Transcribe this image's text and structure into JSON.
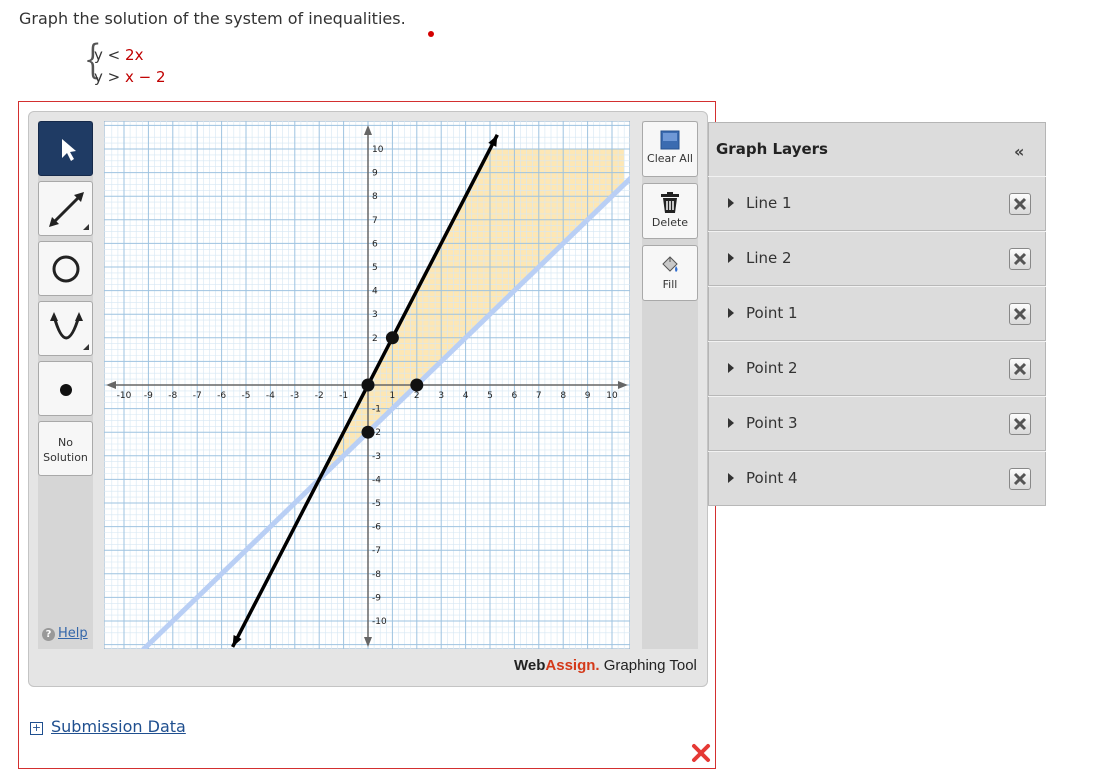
{
  "question": {
    "prompt": "Graph the solution of the system of inequalities.",
    "eq1": {
      "var": "y",
      "op": "<",
      "rhs": "2x"
    },
    "eq2": {
      "var": "y",
      "op": ">",
      "rhs": "x − 2"
    }
  },
  "toolbar": {
    "tools": [
      {
        "name": "pointer",
        "icon": "pointer-arrow-icon",
        "active": true
      },
      {
        "name": "line",
        "icon": "line-tool-icon"
      },
      {
        "name": "circle",
        "icon": "circle-tool-icon"
      },
      {
        "name": "parabola",
        "icon": "parabola-tool-icon"
      },
      {
        "name": "point",
        "icon": "point-tool-icon"
      }
    ],
    "no_solution_line1": "No",
    "no_solution_line2": "Solution",
    "help_label": "Help",
    "help_icon": "question-circle-icon"
  },
  "actions": {
    "clear_all": "Clear All",
    "delete": "Delete",
    "fill": "Fill"
  },
  "graph": {
    "x_range": [
      -10,
      10
    ],
    "y_range": [
      -10,
      10
    ],
    "x_ticks": [
      "-10",
      "-9",
      "-8",
      "-7",
      "-6",
      "-5",
      "-4",
      "-3",
      "-2",
      "-1",
      "1",
      "2",
      "3",
      "4",
      "5",
      "6",
      "7",
      "8",
      "9",
      "10"
    ],
    "y_ticks": [
      "10",
      "9",
      "8",
      "7",
      "6",
      "5",
      "4",
      "3",
      "2",
      "-1",
      "-2",
      "-3",
      "-4",
      "-5",
      "-6",
      "-7",
      "-8",
      "-9",
      "-10"
    ],
    "line1": {
      "equation": "y = 2x",
      "style": "solid",
      "color": "#000000"
    },
    "line2": {
      "equation": "y = x - 2",
      "style": "dashed",
      "color": "#b9cff5"
    },
    "points": [
      {
        "x": 1,
        "y": 2
      },
      {
        "x": 0,
        "y": 0
      },
      {
        "x": 2,
        "y": 0
      },
      {
        "x": 0,
        "y": -2
      }
    ],
    "fill_color": "#fde7b5",
    "grid_color": "#9ec3e0"
  },
  "layers": {
    "title": "Graph Layers",
    "collapse_icon": "«",
    "items": [
      {
        "label": "Line 1"
      },
      {
        "label": "Line 2"
      },
      {
        "label": "Point 1"
      },
      {
        "label": "Point 2"
      },
      {
        "label": "Point 3"
      },
      {
        "label": "Point 4"
      }
    ]
  },
  "brand": {
    "web": "Web",
    "assign": "Assign.",
    "tool": " Graphing Tool"
  },
  "submission": {
    "label": "Submission Data",
    "expand_icon": "+"
  }
}
